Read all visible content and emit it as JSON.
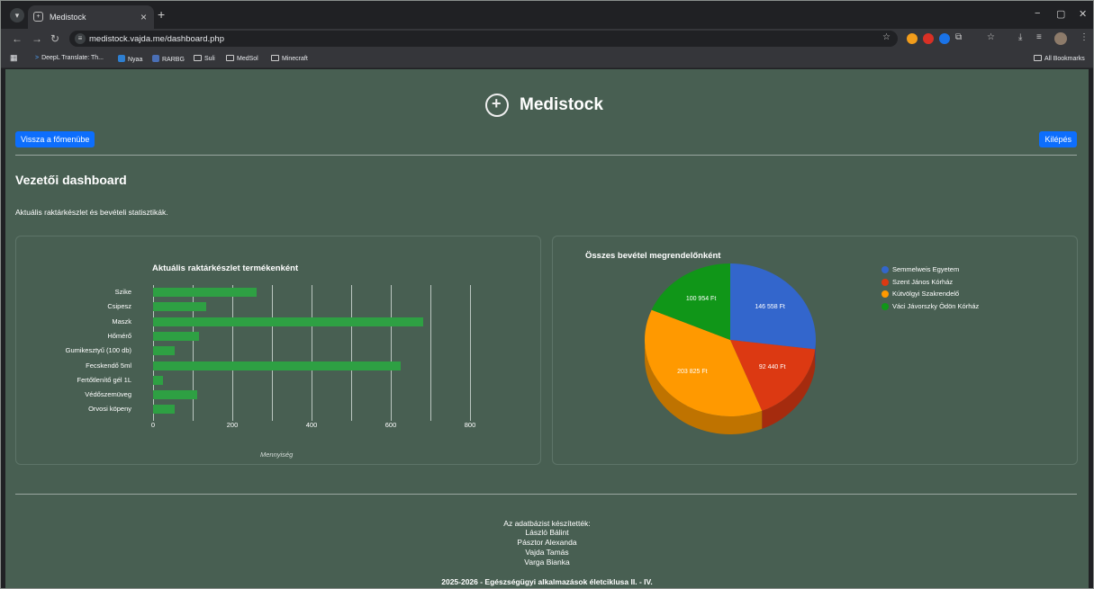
{
  "browser": {
    "tab_title": "Medistock",
    "url": "medistock.vajda.me/dashboard.php",
    "bookmarks": [
      "DeepL Translate: Th...",
      "Nyaa",
      "RARBG",
      "Suli",
      "MedSol",
      "Minecraft"
    ],
    "all_bookmarks": "All Bookmarks"
  },
  "header": {
    "brand": "Medistock",
    "back_button": "Vissza a főmenübe",
    "logout_button": "Kilépés"
  },
  "main": {
    "heading": "Vezetői dashboard",
    "subtitle": "Aktuális raktárkészlet és bevételi statisztikák."
  },
  "stock_chart": {
    "title": "Aktuális raktárkészlet termékenként",
    "xlabel": "Mennyiség",
    "ticks": [
      "0",
      "200",
      "400",
      "600",
      "800"
    ]
  },
  "revenue_chart": {
    "title": "Összes bevétel megrendelőnként",
    "slice_labels": [
      "146 558 Ft",
      "92 440 Ft",
      "203 825 Ft",
      "100 954 Ft"
    ],
    "legend": [
      "Semmelweis Egyetem",
      "Szent János Kórház",
      "Kútvölgyi Szakrendelő",
      "Váci Jávorszky Ödön Kórház"
    ]
  },
  "chart_data": [
    {
      "type": "bar",
      "orientation": "horizontal",
      "title": "Aktuális raktárkészlet termékenként",
      "xlabel": "Mennyiség",
      "categories": [
        "Szike",
        "Csipesz",
        "Maszk",
        "Hőmérő",
        "Gumikesztyű (100 db)",
        "Fecskendő 5ml",
        "Fertőtlenítő gél 1L",
        "Védőszemüveg",
        "Orvosi köpeny"
      ],
      "values": [
        262,
        135,
        682,
        115,
        55,
        625,
        25,
        112,
        55
      ],
      "xlim": [
        0,
        800
      ],
      "color": "#2ea043",
      "grid": true
    },
    {
      "type": "pie",
      "title": "Összes bevétel megrendelőnként",
      "labels": [
        "Semmelweis Egyetem",
        "Szent János Kórház",
        "Kútvölgyi Szakrendelő",
        "Váci Jávorszky Ödön Kórház"
      ],
      "values": [
        146558,
        92440,
        203825,
        100954
      ],
      "colors": [
        "#3366cc",
        "#dc3912",
        "#ff9900",
        "#109618"
      ],
      "legend": "right"
    }
  ],
  "footer": {
    "credits_title": "Az adatbázist készítették:",
    "authors": [
      "László Bálint",
      "Pásztor Alexanda",
      "Vajda Tamás",
      "Varga Bianka"
    ],
    "course": "2025-2026 - Egészségügyi alkalmazások életciklusa II. - IV."
  }
}
